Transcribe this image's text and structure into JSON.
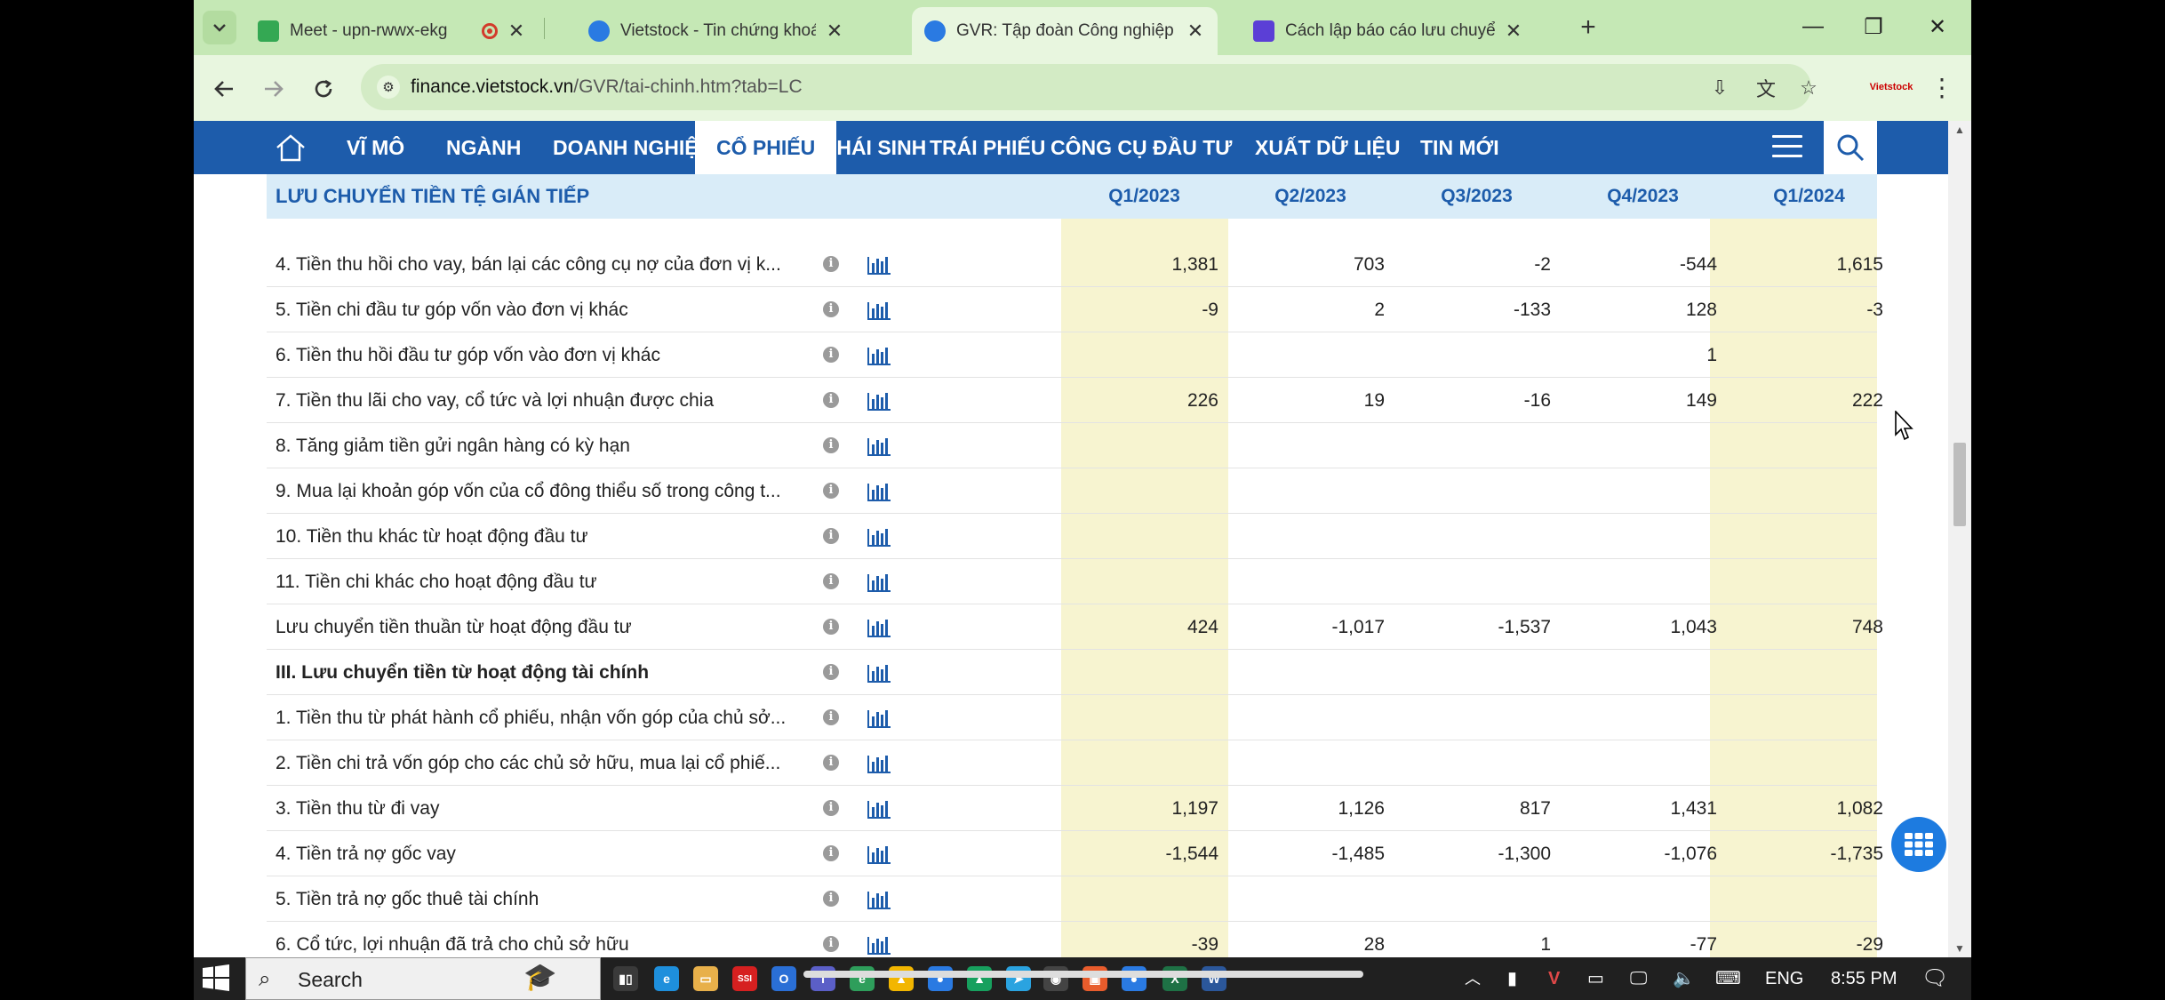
{
  "browser": {
    "tabs": [
      {
        "title": "Meet - upn-rwwx-ekg",
        "favicon_color": "#34a853",
        "recording": true,
        "active": false
      },
      {
        "title": "Vietstock - Tin chứng khoán, bấ",
        "favicon_color": "#2a7ae2",
        "active": false
      },
      {
        "title": "GVR: Tập đoàn Công nghiệp Ca",
        "favicon_color": "#2a7ae2",
        "active": true
      },
      {
        "title": "Cách lập báo cáo lưu chuyển tiề",
        "favicon_color": "#5b3fd6",
        "active": false
      }
    ],
    "url_domain": "finance.vietstock.vn",
    "url_path": "/GVR/tai-chinh.htm?tab=LC",
    "extension_label": "Vietstock"
  },
  "nav": {
    "items": [
      "VĨ MÔ",
      "NGÀNH",
      "DOANH NGHIỆP",
      "CỔ PHIẾU",
      "PHÁI SINH",
      "TRÁI PHIẾU",
      "CÔNG CỤ ĐẦU TƯ",
      "XUẤT DỮ LIỆU",
      "TIN MỚI"
    ],
    "active_index": 3
  },
  "table": {
    "title": "LƯU CHUYỂN TIỀN TỆ GIÁN TIẾP",
    "quarters": [
      "Q1/2023",
      "Q2/2023",
      "Q3/2023",
      "Q4/2023",
      "Q1/2024"
    ],
    "highlight_quarters": [
      "Q1/2023",
      "Q1/2024"
    ],
    "rows": [
      {
        "label": "4. Tiền thu hồi cho vay, bán lại các công cụ nợ của đơn vị k...",
        "bold": false,
        "values": [
          "1,381",
          "703",
          "-2",
          "-544",
          "1,615"
        ]
      },
      {
        "label": "5. Tiền chi đầu tư góp vốn vào đơn vị khác",
        "bold": false,
        "values": [
          "-9",
          "2",
          "-133",
          "128",
          "-3"
        ]
      },
      {
        "label": "6. Tiền thu hồi đầu tư góp vốn vào đơn vị khác",
        "bold": false,
        "values": [
          "",
          "",
          "",
          "1",
          ""
        ]
      },
      {
        "label": "7. Tiền thu lãi cho vay, cổ tức và lợi nhuận được chia",
        "bold": false,
        "values": [
          "226",
          "19",
          "-16",
          "149",
          "222"
        ]
      },
      {
        "label": "8. Tăng giảm tiền gửi ngân hàng có kỳ hạn",
        "bold": false,
        "values": [
          "",
          "",
          "",
          "",
          ""
        ]
      },
      {
        "label": "9. Mua lại khoản góp vốn của cổ đông thiểu số trong công t...",
        "bold": false,
        "values": [
          "",
          "",
          "",
          "",
          ""
        ]
      },
      {
        "label": "10. Tiền thu khác từ hoạt động đầu tư",
        "bold": false,
        "values": [
          "",
          "",
          "",
          "",
          ""
        ]
      },
      {
        "label": "11. Tiền chi khác cho hoạt động đầu tư",
        "bold": false,
        "values": [
          "",
          "",
          "",
          "",
          ""
        ]
      },
      {
        "label": "Lưu chuyển tiền thuần từ hoạt động đầu tư",
        "bold": false,
        "values": [
          "424",
          "-1,017",
          "-1,537",
          "1,043",
          "748"
        ]
      },
      {
        "label": "III. Lưu chuyển tiền từ hoạt động tài chính",
        "bold": true,
        "values": [
          "",
          "",
          "",
          "",
          ""
        ]
      },
      {
        "label": "1. Tiền thu từ phát hành cổ phiếu, nhận vốn góp của chủ sở...",
        "bold": false,
        "values": [
          "",
          "",
          "",
          "",
          ""
        ]
      },
      {
        "label": "2. Tiền chi trả vốn góp cho các chủ sở hữu, mua lại cổ phiế...",
        "bold": false,
        "values": [
          "",
          "",
          "",
          "",
          ""
        ]
      },
      {
        "label": "3. Tiền thu từ đi vay",
        "bold": false,
        "values": [
          "1,197",
          "1,126",
          "817",
          "1,431",
          "1,082"
        ]
      },
      {
        "label": "4. Tiền trả nợ gốc vay",
        "bold": false,
        "values": [
          "-1,544",
          "-1,485",
          "-1,300",
          "-1,076",
          "-1,735"
        ]
      },
      {
        "label": "5. Tiền trả nợ gốc thuê tài chính",
        "bold": false,
        "values": [
          "",
          "",
          "",
          "",
          ""
        ]
      },
      {
        "label": "6. Cổ tức, lợi nhuận đã trả cho chủ sở hữu",
        "bold": false,
        "values": [
          "-39",
          "28",
          "1",
          "-77",
          "-29"
        ]
      }
    ]
  },
  "taskbar": {
    "search_label": "Search",
    "lang": "ENG",
    "time": "8:55 PM",
    "app_icons": [
      {
        "name": "task-view",
        "color": "#3a3a3a",
        "glyph": "▮▯"
      },
      {
        "name": "edge",
        "color": "#1e8fdc",
        "glyph": "e"
      },
      {
        "name": "file-explorer",
        "color": "#e8b04a",
        "glyph": "▭"
      },
      {
        "name": "ssi",
        "color": "#d62020",
        "glyph": "SSI"
      },
      {
        "name": "outlook",
        "color": "#2a6fd6",
        "glyph": "O"
      },
      {
        "name": "teams",
        "color": "#5b5fc7",
        "glyph": "T"
      },
      {
        "name": "edge-beta",
        "color": "#2e9e5b",
        "glyph": "e"
      },
      {
        "name": "drive",
        "color": "#f2b600",
        "glyph": "▲"
      },
      {
        "name": "chrome",
        "color": "#2a7ae2",
        "glyph": "●"
      },
      {
        "name": "google-drive",
        "color": "#17a05e",
        "glyph": "▲"
      },
      {
        "name": "telegram",
        "color": "#2aa3e0",
        "glyph": "➤"
      },
      {
        "name": "obs",
        "color": "#444444",
        "glyph": "◉"
      },
      {
        "name": "photos",
        "color": "#e85c2c",
        "glyph": "▣"
      },
      {
        "name": "chrome-active",
        "color": "#2a7ae2",
        "glyph": "●"
      },
      {
        "name": "excel",
        "color": "#1e7145",
        "glyph": "X"
      },
      {
        "name": "word",
        "color": "#2b579a",
        "glyph": "W"
      }
    ]
  }
}
